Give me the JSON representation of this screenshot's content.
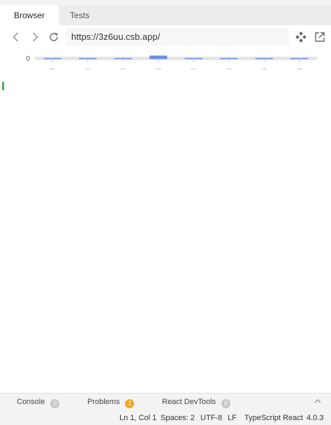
{
  "tabs": {
    "browser": "Browser",
    "tests": "Tests"
  },
  "address": {
    "url": "https://3z6uu.csb.app/"
  },
  "chart_data": {
    "type": "bar",
    "categories": [
      "...",
      "...",
      "...",
      "...",
      "...",
      "...",
      "...",
      "..."
    ],
    "values": [
      0,
      0,
      0,
      0.02,
      0,
      0,
      0,
      0
    ],
    "y_tick_labels": [
      "0"
    ],
    "ylim": [
      0,
      0.02
    ],
    "grid": false,
    "colors": {
      "bar": "#6b8fe6",
      "axis_band": "#e5e5e5"
    }
  },
  "bottom_panel": {
    "console": {
      "label": "Console",
      "count": "0"
    },
    "problems": {
      "label": "Problems",
      "count": "1"
    },
    "devtools": {
      "label": "React DevTools",
      "count": "0"
    }
  },
  "statusbar": {
    "cursor": "Ln 1, Col 1",
    "spaces": "Spaces: 2",
    "encoding": "UTF-8",
    "eol": "LF",
    "language": "TypeScript React",
    "version": "4.0.3"
  }
}
